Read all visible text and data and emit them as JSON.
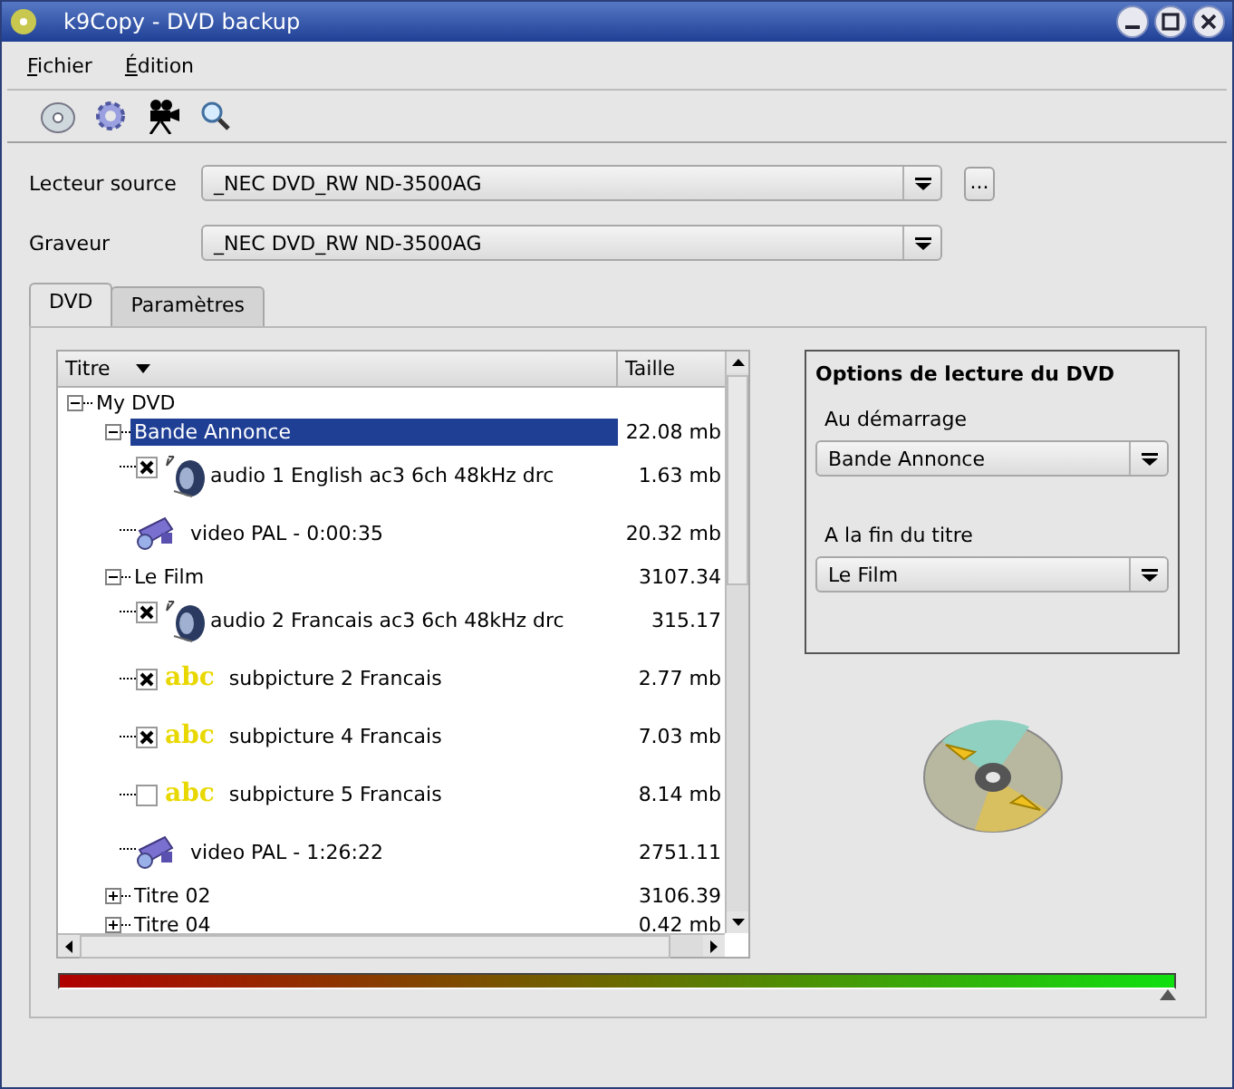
{
  "window": {
    "title": "k9Copy - DVD backup"
  },
  "menu": [
    "Fichier",
    "Édition"
  ],
  "source": {
    "label": "Lecteur source",
    "value": "_NEC DVD_RW ND-3500AG",
    "browse": "..."
  },
  "burner": {
    "label": "Graveur",
    "value": "_NEC DVD_RW ND-3500AG"
  },
  "tabs": [
    {
      "label": "DVD",
      "selected": true
    },
    {
      "label": "Paramètres",
      "selected": false
    }
  ],
  "tree": {
    "columns": [
      "Titre",
      "Taille"
    ],
    "items": [
      {
        "kind": "title",
        "label": "My DVD",
        "expanded": true,
        "selected": false,
        "children": [
          {
            "kind": "title",
            "label": "Bande Annonce",
            "size": "22.08 mb",
            "expanded": true,
            "selected": true,
            "children": [
              {
                "kind": "audio",
                "label": "audio 1 English ac3 6ch 48kHz  drc",
                "size": "1.63 mb",
                "checked": true
              },
              {
                "kind": "video",
                "label": "video PAL - 0:00:35",
                "size": "20.32 mb"
              }
            ]
          },
          {
            "kind": "title",
            "label": "Le Film",
            "size": "3107.34",
            "expanded": true,
            "selected": false,
            "children": [
              {
                "kind": "audio",
                "label": "audio 2 Francais ac3 6ch 48kHz  drc",
                "size": "315.17",
                "checked": true
              },
              {
                "kind": "subpicture",
                "icon_text": "abc",
                "label": "subpicture 2 Francais",
                "size": "2.77 mb",
                "checked": true
              },
              {
                "kind": "subpicture",
                "icon_text": "abc",
                "label": "subpicture 4 Francais",
                "size": "7.03 mb",
                "checked": true
              },
              {
                "kind": "subpicture",
                "icon_text": "abc",
                "label": "subpicture 5 Francais",
                "size": "8.14 mb",
                "checked": false
              },
              {
                "kind": "video",
                "label": "video PAL - 1:26:22",
                "size": "2751.11"
              }
            ]
          },
          {
            "kind": "title",
            "label": "Titre 02",
            "size": "3106.39",
            "expanded": false,
            "selected": false
          },
          {
            "kind": "title",
            "label": "Titre 04",
            "size": "0.42 mb",
            "expanded": false,
            "selected": false
          }
        ]
      }
    ]
  },
  "options": {
    "title": "Options de lecture du DVD",
    "start_label": "Au démarrage",
    "start_value": "Bande Annonce",
    "end_label": "A la fin du titre",
    "end_value": "Le Film"
  },
  "size_meter": {
    "level": 1.0
  }
}
